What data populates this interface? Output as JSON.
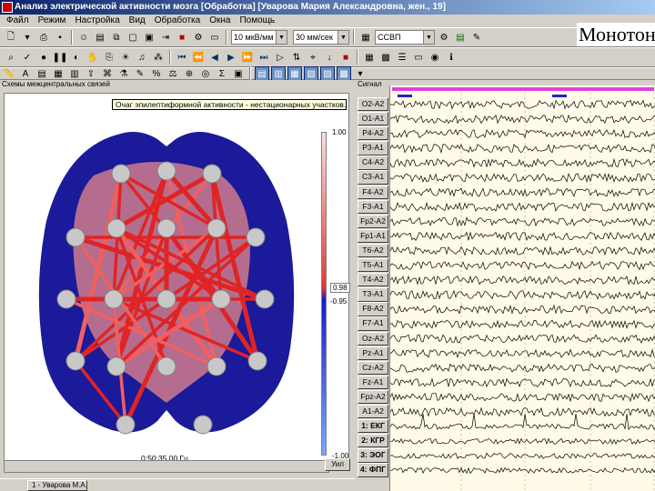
{
  "window": {
    "title": "Анализ электрической активности мозга [Обработка] [Уварова Мария Александровна, жен., 19]",
    "overlay_text": "Монотон"
  },
  "menu": [
    "Файл",
    "Режим",
    "Настройка",
    "Вид",
    "Обработка",
    "Окна",
    "Помощь"
  ],
  "toolbar": {
    "sensitivity": "10 мкВ/мм",
    "speed": "30 мм/сек",
    "mode": "ССВП"
  },
  "left_panel": {
    "title": "Схемы межцентральных связей",
    "tooltip": "Очаг эпилептиформной активности - нестационарных участков.",
    "scale_max": "1.00",
    "scale_mid": "0.98",
    "scale_neg": "-0.95",
    "scale_min": "-1.00",
    "time": "0:50:35.00 Гц",
    "button": "Уил"
  },
  "signals_header": "Сигнал",
  "channels": [
    {
      "label": "O2-A2",
      "bold": false
    },
    {
      "label": "O1-A1",
      "bold": false
    },
    {
      "label": "P4-A2",
      "bold": false
    },
    {
      "label": "P3-A1",
      "bold": false
    },
    {
      "label": "C4-A2",
      "bold": false
    },
    {
      "label": "C3-A1",
      "bold": false
    },
    {
      "label": "F4-A2",
      "bold": false
    },
    {
      "label": "F3-A1",
      "bold": false
    },
    {
      "label": "Fp2-A2",
      "bold": false
    },
    {
      "label": "Fp1-A1",
      "bold": false
    },
    {
      "label": "T6-A2",
      "bold": false
    },
    {
      "label": "T5-A1",
      "bold": false
    },
    {
      "label": "T4-A2",
      "bold": false
    },
    {
      "label": "T3-A1",
      "bold": false
    },
    {
      "label": "F8-A2",
      "bold": false
    },
    {
      "label": "F7-A1",
      "bold": false
    },
    {
      "label": "Oz-A2",
      "bold": false
    },
    {
      "label": "Pz-A1",
      "bold": false
    },
    {
      "label": "Cz-A2",
      "bold": false
    },
    {
      "label": "Fz-A1",
      "bold": false
    },
    {
      "label": "Fpz-A2",
      "bold": false
    },
    {
      "label": "A1-A2",
      "bold": false
    },
    {
      "label": "1: ЕКГ",
      "bold": true
    },
    {
      "label": "2: КГР",
      "bold": true
    },
    {
      "label": "3: ЭОГ",
      "bold": true
    },
    {
      "label": "4: ФПГ",
      "bold": true
    }
  ],
  "taskbar": {
    "item": "1 - Уварова М.А."
  }
}
